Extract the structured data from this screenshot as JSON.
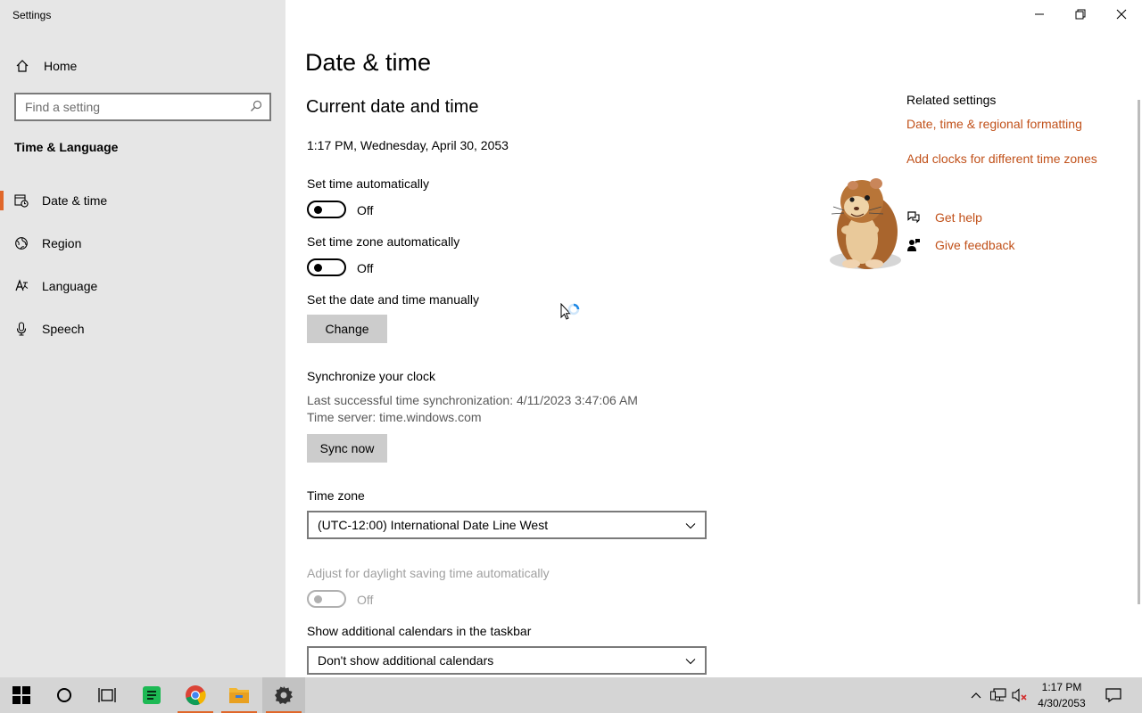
{
  "window": {
    "title": "Settings",
    "minimize_label": "Minimize",
    "restore_label": "Restore",
    "close_label": "Close"
  },
  "sidebar": {
    "home_label": "Home",
    "search_placeholder": "Find a setting",
    "section_title": "Time & Language",
    "items": [
      {
        "label": "Date & time",
        "icon": "date-time-icon",
        "active": true
      },
      {
        "label": "Region",
        "icon": "region-icon",
        "active": false
      },
      {
        "label": "Language",
        "icon": "language-icon",
        "active": false
      },
      {
        "label": "Speech",
        "icon": "microphone-icon",
        "active": false
      }
    ]
  },
  "main": {
    "page_title": "Date & time",
    "section_title": "Current date and time",
    "current_datetime": "1:17 PM, Wednesday, April 30, 2053",
    "set_time_auto": {
      "label": "Set time automatically",
      "state": "Off"
    },
    "set_tz_auto": {
      "label": "Set time zone automatically",
      "state": "Off"
    },
    "manual": {
      "label": "Set the date and time manually",
      "button": "Change"
    },
    "sync": {
      "title": "Synchronize your clock",
      "last_sync": "Last successful time synchronization: 4/11/2023 3:47:06 AM",
      "server": "Time server: time.windows.com",
      "button": "Sync now"
    },
    "time_zone": {
      "label": "Time zone",
      "value": "(UTC-12:00) International Date Line West"
    },
    "daylight": {
      "label": "Adjust for daylight saving time automatically",
      "state": "Off"
    },
    "calendars": {
      "label": "Show additional calendars in the taskbar",
      "value": "Don't show additional calendars"
    }
  },
  "related": {
    "heading": "Related settings",
    "links": [
      "Date, time & regional formatting",
      "Add clocks for different time zones"
    ],
    "get_help": "Get help",
    "give_feedback": "Give feedback"
  },
  "taskbar": {
    "apps": [
      "start-icon",
      "cortana-icon",
      "task-view-icon",
      "sheets-icon",
      "chrome-icon",
      "file-explorer-icon",
      "settings-gear-icon"
    ],
    "time": "1:17 PM",
    "date": "4/30/2053"
  },
  "colors": {
    "accent": "#e0672a",
    "link": "#c1511a",
    "sidebar_bg": "#e6e6e6",
    "taskbar_bg": "#d5d5d5"
  }
}
